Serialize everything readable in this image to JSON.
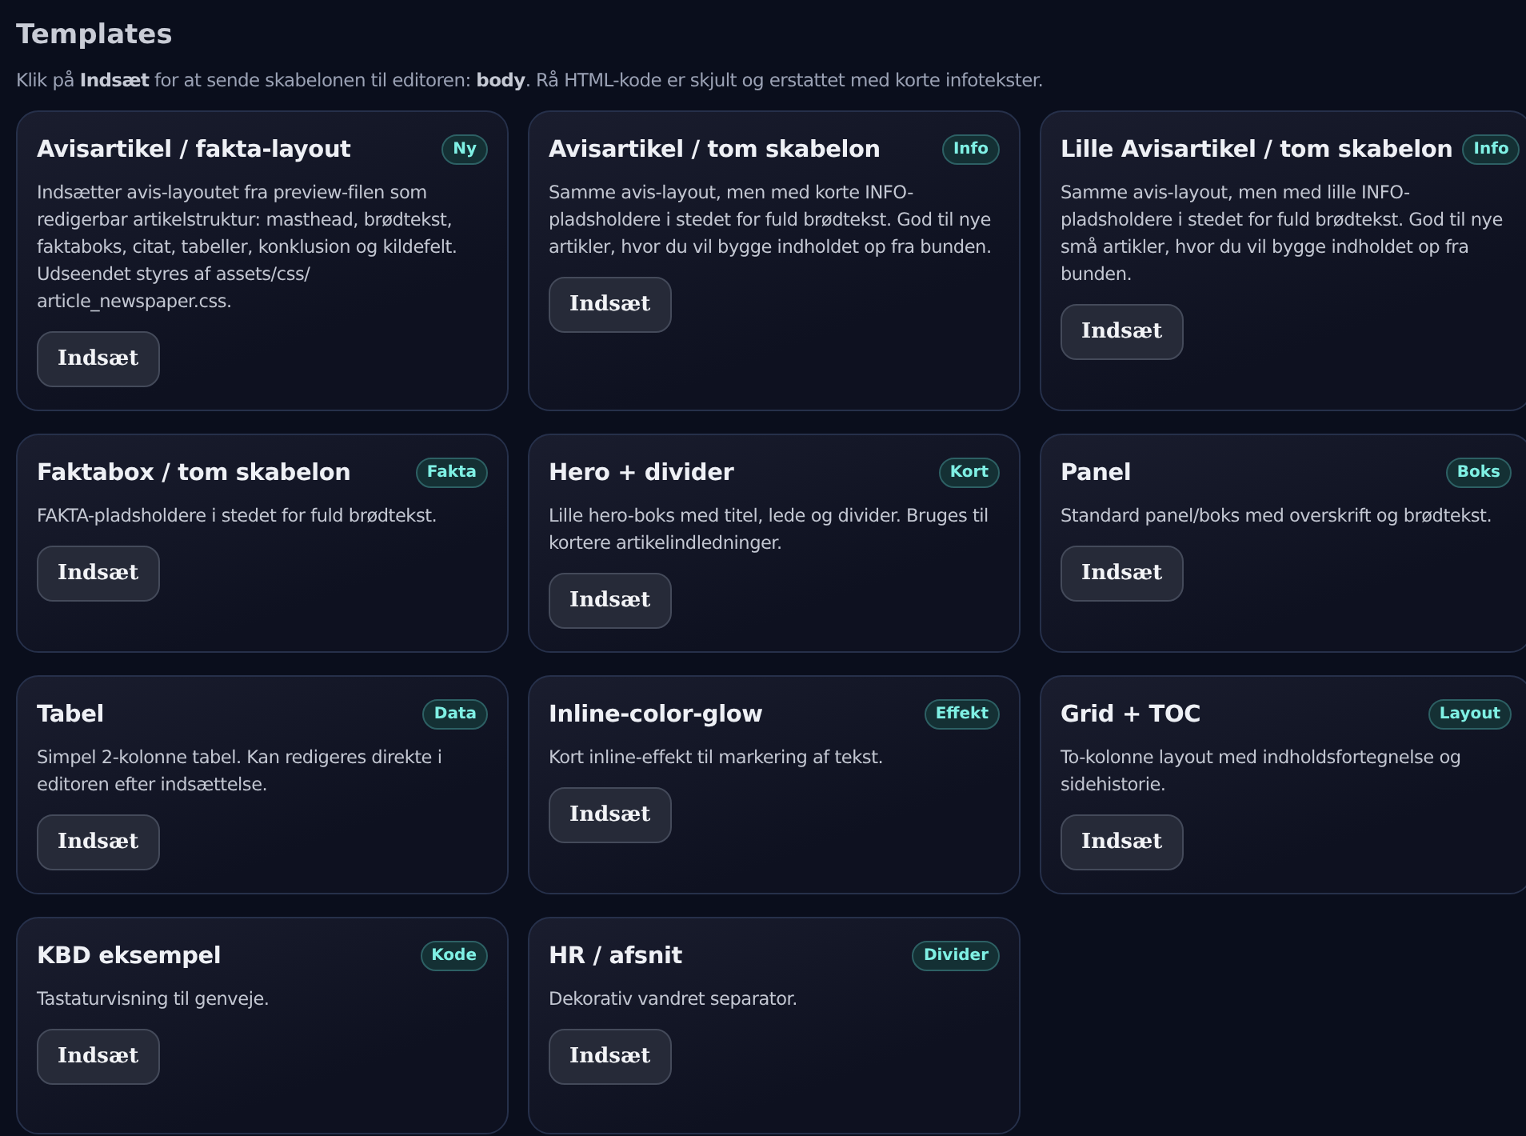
{
  "title": "Templates",
  "subtitle": "Klik på **Indsæt** for at sende skabelonen til editoren: **body**. Rå HTML-kode er skjult og erstattet med korte infotekster.",
  "templates": [
    {
      "name": "Avisartikel / fakta-layout",
      "tag": "Ny",
      "description": "Indsætter avis-layoutet fra preview-filen som redigerbar artikelstruktur: masthead, brødtekst, faktaboks, citat, tabeller, konklusion og kildefelt. Udseendet styres af assets/css/ article_newspaper.css.",
      "button": "Indsæt"
    },
    {
      "name": "Avisartikel / tom skabelon",
      "tag": "Info",
      "description": "Samme avis-layout, men med korte INFO-pladsholdere i stedet for fuld brødtekst. God til nye artikler, hvor du vil bygge indholdet op fra bunden.",
      "button": "Indsæt"
    },
    {
      "name": "Lille Avisartikel / tom skabelon",
      "tag": "Info",
      "description": "Samme avis-layout, men med lille INFO-pladsholdere i stedet for fuld brødtekst. God til nye små artikler, hvor du vil bygge indholdet op fra bunden.",
      "button": "Indsæt"
    },
    {
      "name": "Faktabox / tom skabelon",
      "tag": "Fakta",
      "description": "FAKTA-pladsholdere i stedet for fuld brødtekst.",
      "button": "Indsæt"
    },
    {
      "name": "Hero + divider",
      "tag": "Kort",
      "description": "Lille hero-boks med titel, lede og divider. Bruges til kortere artikelindledninger.",
      "button": "Indsæt"
    },
    {
      "name": "Panel",
      "tag": "Boks",
      "description": "Standard panel/boks med overskrift og brødtekst.",
      "button": "Indsæt"
    },
    {
      "name": "Tabel",
      "tag": "Data",
      "description": "Simpel 2-kolonne tabel. Kan redigeres direkte i editoren efter indsættelse.",
      "button": "Indsæt"
    },
    {
      "name": "Inline-color-glow",
      "tag": "Effekt",
      "description": "Kort inline-effekt til markering af tekst.",
      "button": "Indsæt"
    },
    {
      "name": "Grid + TOC",
      "tag": "Layout",
      "description": "To-kolonne layout med indholdsfortegnelse og sidehistorie.",
      "button": "Indsæt"
    },
    {
      "name": "KBD eksempel",
      "tag": "Kode",
      "description": "Tastaturvisning til genveje.",
      "button": "Indsæt"
    },
    {
      "name": "HR / afsnit",
      "tag": "Divider",
      "description": "Dekorativ vandret separator.",
      "button": "Indsæt"
    }
  ]
}
